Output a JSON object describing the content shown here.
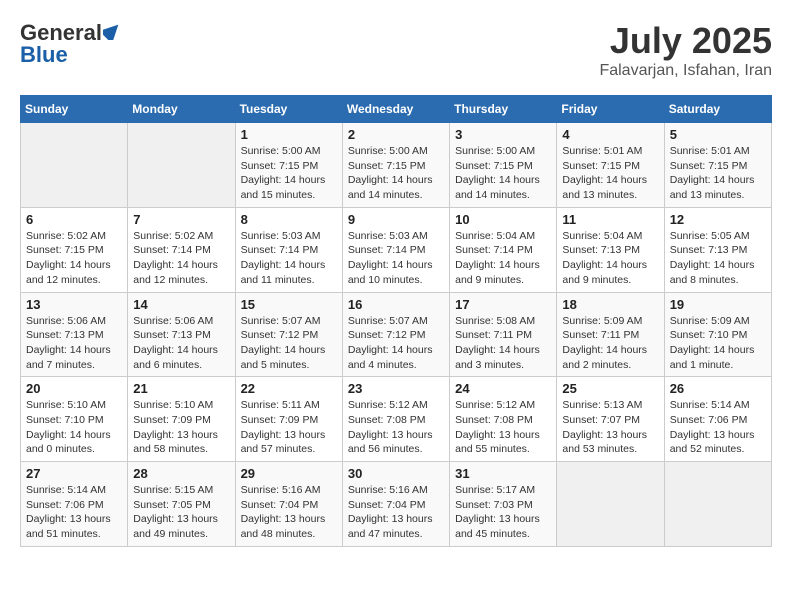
{
  "header": {
    "logo_general": "General",
    "logo_blue": "Blue",
    "title": "July 2025",
    "subtitle": "Falavarjan, Isfahan, Iran"
  },
  "calendar": {
    "days_of_week": [
      "Sunday",
      "Monday",
      "Tuesday",
      "Wednesday",
      "Thursday",
      "Friday",
      "Saturday"
    ],
    "weeks": [
      [
        {
          "day": "",
          "detail": ""
        },
        {
          "day": "",
          "detail": ""
        },
        {
          "day": "1",
          "detail": "Sunrise: 5:00 AM\nSunset: 7:15 PM\nDaylight: 14 hours\nand 15 minutes."
        },
        {
          "day": "2",
          "detail": "Sunrise: 5:00 AM\nSunset: 7:15 PM\nDaylight: 14 hours\nand 14 minutes."
        },
        {
          "day": "3",
          "detail": "Sunrise: 5:00 AM\nSunset: 7:15 PM\nDaylight: 14 hours\nand 14 minutes."
        },
        {
          "day": "4",
          "detail": "Sunrise: 5:01 AM\nSunset: 7:15 PM\nDaylight: 14 hours\nand 13 minutes."
        },
        {
          "day": "5",
          "detail": "Sunrise: 5:01 AM\nSunset: 7:15 PM\nDaylight: 14 hours\nand 13 minutes."
        }
      ],
      [
        {
          "day": "6",
          "detail": "Sunrise: 5:02 AM\nSunset: 7:15 PM\nDaylight: 14 hours\nand 12 minutes."
        },
        {
          "day": "7",
          "detail": "Sunrise: 5:02 AM\nSunset: 7:14 PM\nDaylight: 14 hours\nand 12 minutes."
        },
        {
          "day": "8",
          "detail": "Sunrise: 5:03 AM\nSunset: 7:14 PM\nDaylight: 14 hours\nand 11 minutes."
        },
        {
          "day": "9",
          "detail": "Sunrise: 5:03 AM\nSunset: 7:14 PM\nDaylight: 14 hours\nand 10 minutes."
        },
        {
          "day": "10",
          "detail": "Sunrise: 5:04 AM\nSunset: 7:14 PM\nDaylight: 14 hours\nand 9 minutes."
        },
        {
          "day": "11",
          "detail": "Sunrise: 5:04 AM\nSunset: 7:13 PM\nDaylight: 14 hours\nand 9 minutes."
        },
        {
          "day": "12",
          "detail": "Sunrise: 5:05 AM\nSunset: 7:13 PM\nDaylight: 14 hours\nand 8 minutes."
        }
      ],
      [
        {
          "day": "13",
          "detail": "Sunrise: 5:06 AM\nSunset: 7:13 PM\nDaylight: 14 hours\nand 7 minutes."
        },
        {
          "day": "14",
          "detail": "Sunrise: 5:06 AM\nSunset: 7:13 PM\nDaylight: 14 hours\nand 6 minutes."
        },
        {
          "day": "15",
          "detail": "Sunrise: 5:07 AM\nSunset: 7:12 PM\nDaylight: 14 hours\nand 5 minutes."
        },
        {
          "day": "16",
          "detail": "Sunrise: 5:07 AM\nSunset: 7:12 PM\nDaylight: 14 hours\nand 4 minutes."
        },
        {
          "day": "17",
          "detail": "Sunrise: 5:08 AM\nSunset: 7:11 PM\nDaylight: 14 hours\nand 3 minutes."
        },
        {
          "day": "18",
          "detail": "Sunrise: 5:09 AM\nSunset: 7:11 PM\nDaylight: 14 hours\nand 2 minutes."
        },
        {
          "day": "19",
          "detail": "Sunrise: 5:09 AM\nSunset: 7:10 PM\nDaylight: 14 hours\nand 1 minute."
        }
      ],
      [
        {
          "day": "20",
          "detail": "Sunrise: 5:10 AM\nSunset: 7:10 PM\nDaylight: 14 hours\nand 0 minutes."
        },
        {
          "day": "21",
          "detail": "Sunrise: 5:10 AM\nSunset: 7:09 PM\nDaylight: 13 hours\nand 58 minutes."
        },
        {
          "day": "22",
          "detail": "Sunrise: 5:11 AM\nSunset: 7:09 PM\nDaylight: 13 hours\nand 57 minutes."
        },
        {
          "day": "23",
          "detail": "Sunrise: 5:12 AM\nSunset: 7:08 PM\nDaylight: 13 hours\nand 56 minutes."
        },
        {
          "day": "24",
          "detail": "Sunrise: 5:12 AM\nSunset: 7:08 PM\nDaylight: 13 hours\nand 55 minutes."
        },
        {
          "day": "25",
          "detail": "Sunrise: 5:13 AM\nSunset: 7:07 PM\nDaylight: 13 hours\nand 53 minutes."
        },
        {
          "day": "26",
          "detail": "Sunrise: 5:14 AM\nSunset: 7:06 PM\nDaylight: 13 hours\nand 52 minutes."
        }
      ],
      [
        {
          "day": "27",
          "detail": "Sunrise: 5:14 AM\nSunset: 7:06 PM\nDaylight: 13 hours\nand 51 minutes."
        },
        {
          "day": "28",
          "detail": "Sunrise: 5:15 AM\nSunset: 7:05 PM\nDaylight: 13 hours\nand 49 minutes."
        },
        {
          "day": "29",
          "detail": "Sunrise: 5:16 AM\nSunset: 7:04 PM\nDaylight: 13 hours\nand 48 minutes."
        },
        {
          "day": "30",
          "detail": "Sunrise: 5:16 AM\nSunset: 7:04 PM\nDaylight: 13 hours\nand 47 minutes."
        },
        {
          "day": "31",
          "detail": "Sunrise: 5:17 AM\nSunset: 7:03 PM\nDaylight: 13 hours\nand 45 minutes."
        },
        {
          "day": "",
          "detail": ""
        },
        {
          "day": "",
          "detail": ""
        }
      ]
    ]
  }
}
